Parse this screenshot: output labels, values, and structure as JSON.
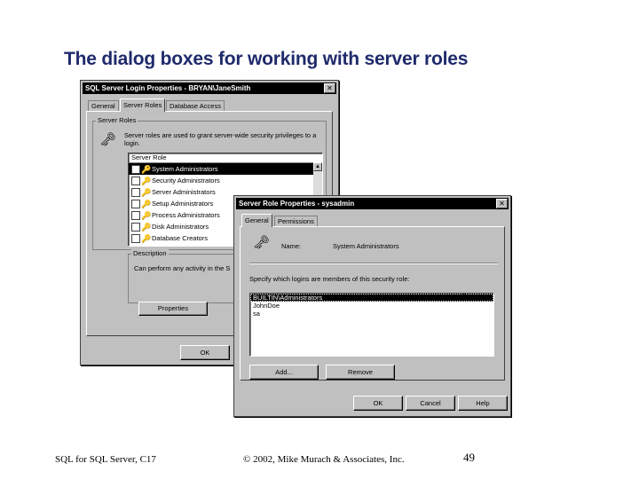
{
  "slide": {
    "title": "The dialog boxes for working with server roles",
    "footer_left": "SQL for SQL Server, C17",
    "footer_center": "© 2002, Mike Murach & Associates, Inc.",
    "page_number": "49"
  },
  "login_dialog": {
    "title": "SQL Server Login Properties - BRYAN\\JaneSmith",
    "close_label": "✕",
    "tabs": [
      "General",
      "Server Roles",
      "Database Access"
    ],
    "active_tab": "Server Roles",
    "group_label": "Server Roles",
    "description_text": "Server roles are used to grant server-wide security privileges to a login.",
    "list_header": "Server Role",
    "roles": [
      {
        "label": "System Administrators",
        "selected": true
      },
      {
        "label": "Security Administrators",
        "selected": false
      },
      {
        "label": "Server Administrators",
        "selected": false
      },
      {
        "label": "Setup Administrators",
        "selected": false
      },
      {
        "label": "Process Administrators",
        "selected": false
      },
      {
        "label": "Disk Administrators",
        "selected": false
      },
      {
        "label": "Database Creators",
        "selected": false
      }
    ],
    "description_group_label": "Description",
    "description_value": "Can perform any activity in the S",
    "properties_button": "Properties",
    "ok_button": "OK"
  },
  "role_dialog": {
    "title": "Server Role Properties - sysadmin",
    "close_label": "✕",
    "tabs": [
      "General",
      "Permissions"
    ],
    "active_tab": "General",
    "name_label": "Name:",
    "name_value": "System Administrators",
    "instructions": "Specify which logins are members of this security role:",
    "members": [
      {
        "label": "BUILTIN\\Administrators",
        "selected": true
      },
      {
        "label": "JohnDoe",
        "selected": false
      },
      {
        "label": "sa",
        "selected": false
      }
    ],
    "add_button": "Add...",
    "remove_button": "Remove",
    "ok_button": "OK",
    "cancel_button": "Cancel",
    "help_button": "Help"
  },
  "icons": {
    "role_icon": "key-icon",
    "cursor": "arrow-cursor-icon"
  }
}
